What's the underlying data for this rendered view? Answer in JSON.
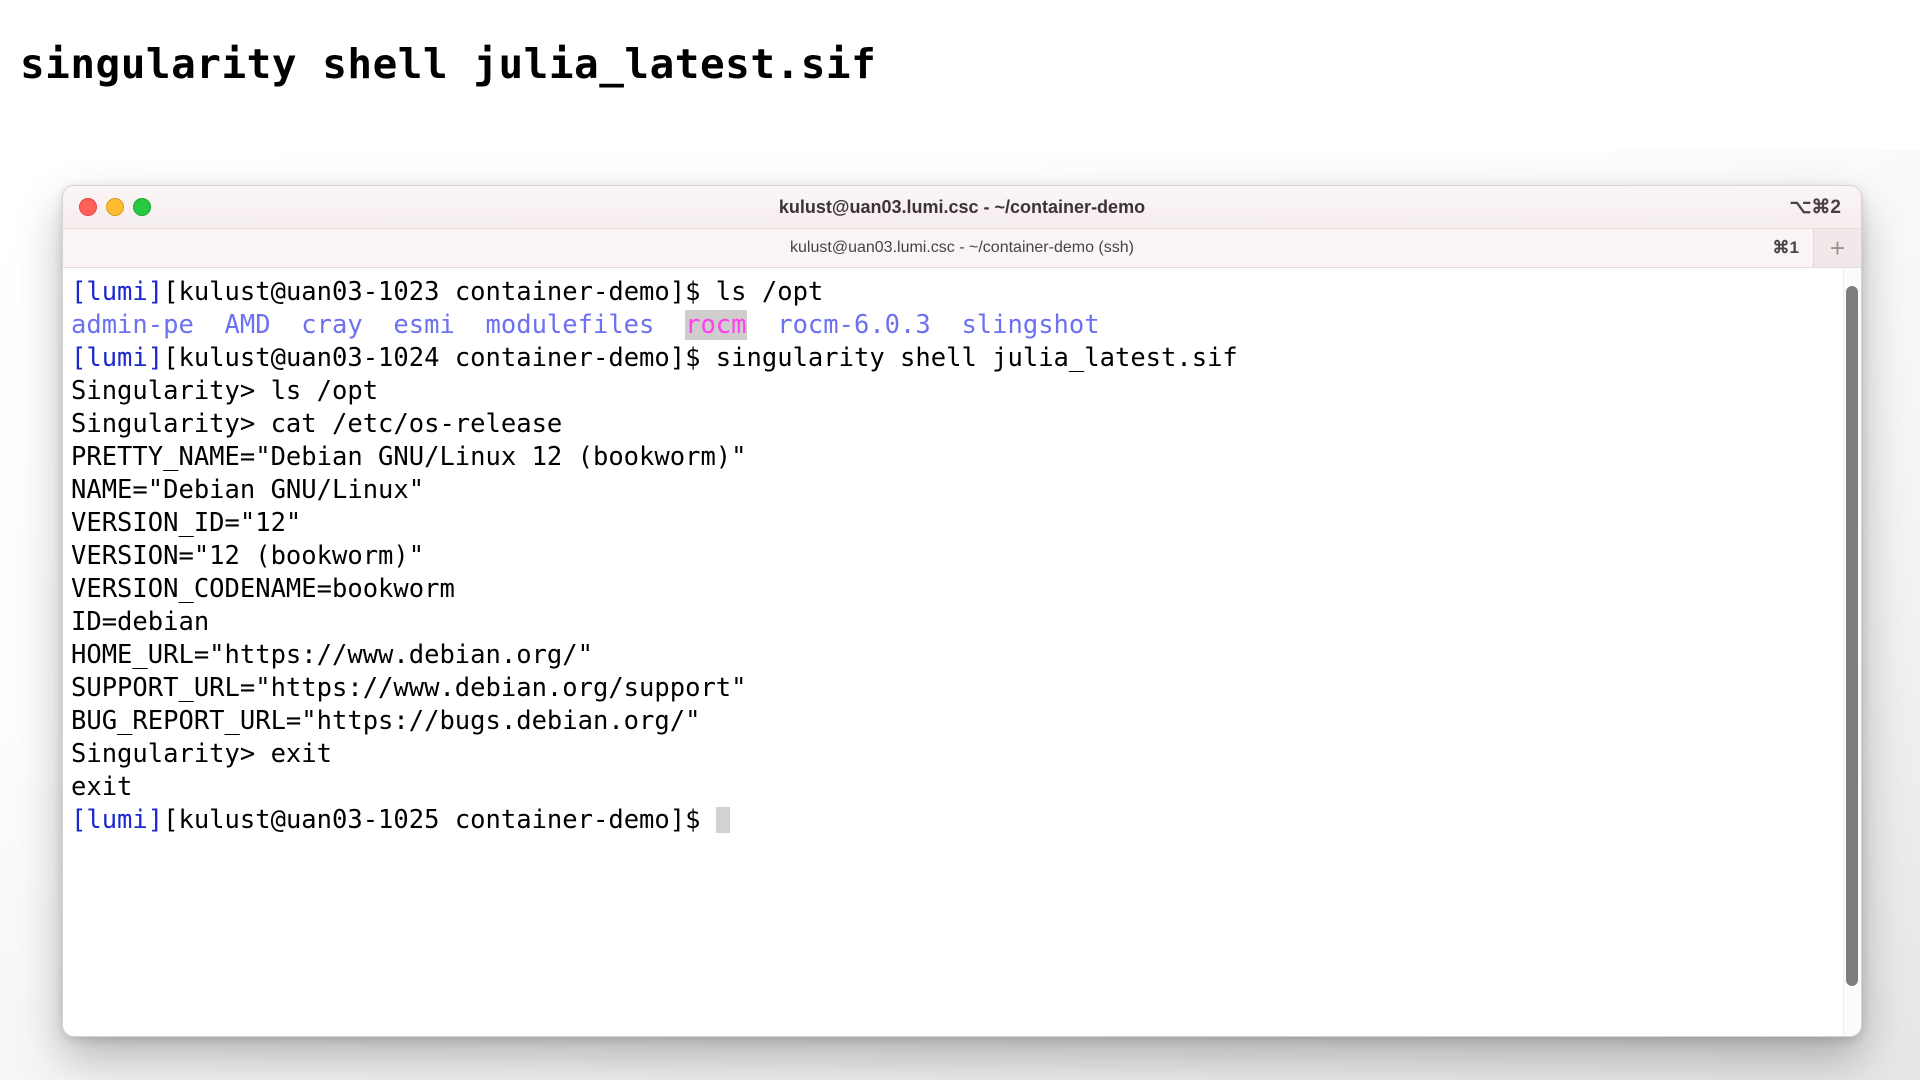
{
  "heading": "singularity shell julia_latest.sif",
  "window": {
    "title": "kulust@uan03.lumi.csc - ~/container-demo",
    "shortcut": "⌥⌘2",
    "traffic_lights": {
      "close_label": "close",
      "minimize_label": "minimize",
      "maximize_label": "maximize",
      "close_color": "#ff5f57",
      "minimize_color": "#febc2e",
      "maximize_color": "#28c840"
    }
  },
  "tabbar": {
    "tab_title": "kulust@uan03.lumi.csc - ~/container-demo (ssh)",
    "shortcut": "⌘1",
    "new_tab_label": "+"
  },
  "terminal": {
    "colors": {
      "prompt_host": "#1a28cc",
      "directory": "#6c71f0",
      "symlink": "#ff3ff0",
      "symlink_bg": "#d0cdcd",
      "text": "#000000",
      "background": "#ffffff"
    },
    "lines": [
      {
        "segments": [
          {
            "text": "[lumi]",
            "style": "lumi"
          },
          {
            "text": "[kulust@uan03-1023 container-demo]$ ls /opt",
            "style": "plain"
          }
        ]
      },
      {
        "segments": [
          {
            "text": "admin-pe  AMD  cray  esmi  modulefiles  ",
            "style": "dir"
          },
          {
            "text": "rocm",
            "style": "link"
          },
          {
            "text": "  rocm-6.0.3  slingshot",
            "style": "dir"
          }
        ]
      },
      {
        "segments": [
          {
            "text": "[lumi]",
            "style": "lumi"
          },
          {
            "text": "[kulust@uan03-1024 container-demo]$ singularity shell julia_latest.sif",
            "style": "plain"
          }
        ]
      },
      {
        "segments": [
          {
            "text": "Singularity> ls /opt",
            "style": "plain"
          }
        ]
      },
      {
        "segments": [
          {
            "text": "Singularity> cat /etc/os-release",
            "style": "plain"
          }
        ]
      },
      {
        "segments": [
          {
            "text": "PRETTY_NAME=\"Debian GNU/Linux 12 (bookworm)\"",
            "style": "plain"
          }
        ]
      },
      {
        "segments": [
          {
            "text": "NAME=\"Debian GNU/Linux\"",
            "style": "plain"
          }
        ]
      },
      {
        "segments": [
          {
            "text": "VERSION_ID=\"12\"",
            "style": "plain"
          }
        ]
      },
      {
        "segments": [
          {
            "text": "VERSION=\"12 (bookworm)\"",
            "style": "plain"
          }
        ]
      },
      {
        "segments": [
          {
            "text": "VERSION_CODENAME=bookworm",
            "style": "plain"
          }
        ]
      },
      {
        "segments": [
          {
            "text": "ID=debian",
            "style": "plain"
          }
        ]
      },
      {
        "segments": [
          {
            "text": "HOME_URL=\"https://www.debian.org/\"",
            "style": "plain"
          }
        ]
      },
      {
        "segments": [
          {
            "text": "SUPPORT_URL=\"https://www.debian.org/support\"",
            "style": "plain"
          }
        ]
      },
      {
        "segments": [
          {
            "text": "BUG_REPORT_URL=\"https://bugs.debian.org/\"",
            "style": "plain"
          }
        ]
      },
      {
        "segments": [
          {
            "text": "Singularity> exit",
            "style": "plain"
          }
        ]
      },
      {
        "segments": [
          {
            "text": "exit",
            "style": "plain"
          }
        ]
      },
      {
        "segments": [
          {
            "text": "[lumi]",
            "style": "lumi"
          },
          {
            "text": "[kulust@uan03-1025 container-demo]$ ",
            "style": "plain"
          },
          {
            "text": "",
            "style": "cursor"
          }
        ]
      }
    ]
  }
}
